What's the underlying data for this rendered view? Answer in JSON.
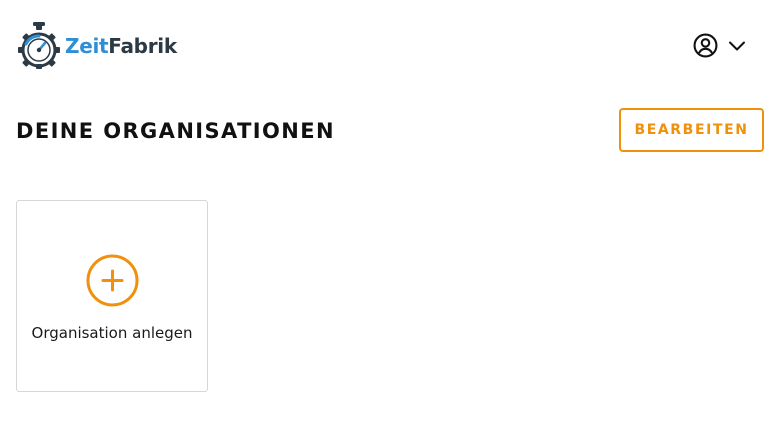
{
  "brand": {
    "name_part1": "Zeit",
    "name_part2": "Fabrik",
    "logo_icon": "stopwatch-gear-icon",
    "colors": {
      "primary": "#2f8fd6",
      "dark": "#2b3a45"
    }
  },
  "header": {
    "user_icon": "user-circle-icon",
    "menu_icon": "chevron-down-icon"
  },
  "main": {
    "title": "DEINE ORGANISATIONEN",
    "edit_label": "BEARBEITEN",
    "accent_color": "#f0900c",
    "cards": [
      {
        "icon": "plus-circle-icon",
        "label": "Organisation anlegen"
      }
    ]
  }
}
